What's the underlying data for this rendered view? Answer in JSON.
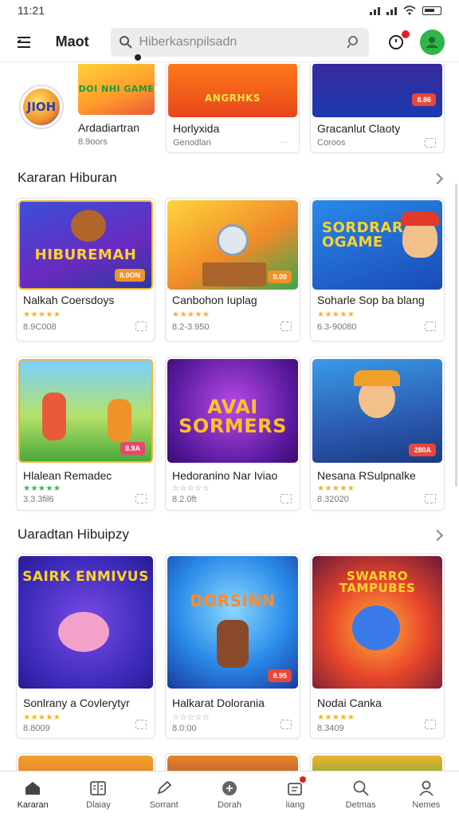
{
  "status": {
    "time": "11:21"
  },
  "header": {
    "title": "Maot",
    "search_placeholder": "Hiberkasnpilsadn"
  },
  "top_row": [
    {
      "title": "Ardadiartran",
      "meta": "8.9oors"
    },
    {
      "title": "Horlyxida",
      "meta": "Genodlan"
    },
    {
      "title": "Gracanlut Claoty",
      "meta": "Coroos"
    }
  ],
  "sections": [
    {
      "title": "Kararan Hiburan"
    },
    {
      "title": "Uaradtan Hibuipzy"
    }
  ],
  "cards": [
    {
      "title": "Nalkah Coersdoys",
      "meta": "8.9C008",
      "art": "HIBUREMAH",
      "tag": "8.0ON"
    },
    {
      "title": "Canbohon Iuplag",
      "meta": "8.2-3.950",
      "art": "",
      "tag": "0.00"
    },
    {
      "title": "Soharle Sop ba blang",
      "meta": "6.3-90080",
      "art": "SORDRAR OGAME",
      "tag": ""
    },
    {
      "title": "Hlalean Remadec",
      "meta": "3.3.3fil6",
      "art": "",
      "tag": "8.9A"
    },
    {
      "title": "Hedoranino Nar Iviao",
      "meta": "8.2.0ft",
      "art": "AVAI SORMERS",
      "tag": ""
    },
    {
      "title": "Nesana RSulpnalke",
      "meta": "8.32020",
      "art": "",
      "tag": "280A"
    },
    {
      "title": "Sonlrany a Covlerytyr",
      "meta": "8.8009",
      "art": "SAIRK ENMIVUS",
      "tag": ""
    },
    {
      "title": "Halkarat Dolorania",
      "meta": "8.0:00",
      "art": "DORSINN",
      "tag": "8.95"
    },
    {
      "title": "Nodai Canka",
      "meta": "8.3409",
      "art": "SWARRO TAMPUBES",
      "tag": ""
    }
  ],
  "nav": [
    {
      "label": "Kararan",
      "icon": "home-icon"
    },
    {
      "label": "Dlaiay",
      "icon": "book-icon"
    },
    {
      "label": "Sorrant",
      "icon": "pen-icon"
    },
    {
      "label": "Dorah",
      "icon": "add-circle-icon"
    },
    {
      "label": "Iiang",
      "icon": "gift-icon"
    },
    {
      "label": "Detmas",
      "icon": "search-icon"
    },
    {
      "label": "Nemes",
      "icon": "user-icon"
    }
  ],
  "colors": {
    "accent": "#31b54a",
    "badge": "#e32020",
    "star": "#f3b51c"
  }
}
